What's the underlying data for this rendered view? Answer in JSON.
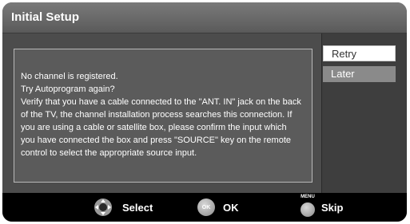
{
  "dialog": {
    "title": "Initial Setup",
    "message_lines": [
      "No channel is registered.",
      "Try Autoprogram again?",
      "Verify that you have a cable connected to the \"ANT. IN\" jack on the  back",
      "of the TV, the channel installation process searches this connection. If",
      "you are using a cable or satellite box, please confirm the input which",
      "you have connected the box and press \"SOURCE\" key on the remote",
      "control to select the appropriate source input."
    ],
    "options": [
      {
        "label": "Retry",
        "selected": true
      },
      {
        "label": "Later",
        "selected": false
      }
    ]
  },
  "footer": {
    "select": {
      "icon": "dpad-icon",
      "label": "Select"
    },
    "ok": {
      "icon": "ok-button-icon",
      "button_text": "OK",
      "label": "OK"
    },
    "skip": {
      "icon": "menu-button-icon",
      "button_text": "MENU",
      "label": "Skip"
    }
  },
  "colors": {
    "panel": "#4c4c4c",
    "side_panel": "#3e3e3e",
    "message_box": "#5b5b5b",
    "selected_option": "#ffffff",
    "unselected_option": "#8a8a8a",
    "footer": "#000000"
  }
}
